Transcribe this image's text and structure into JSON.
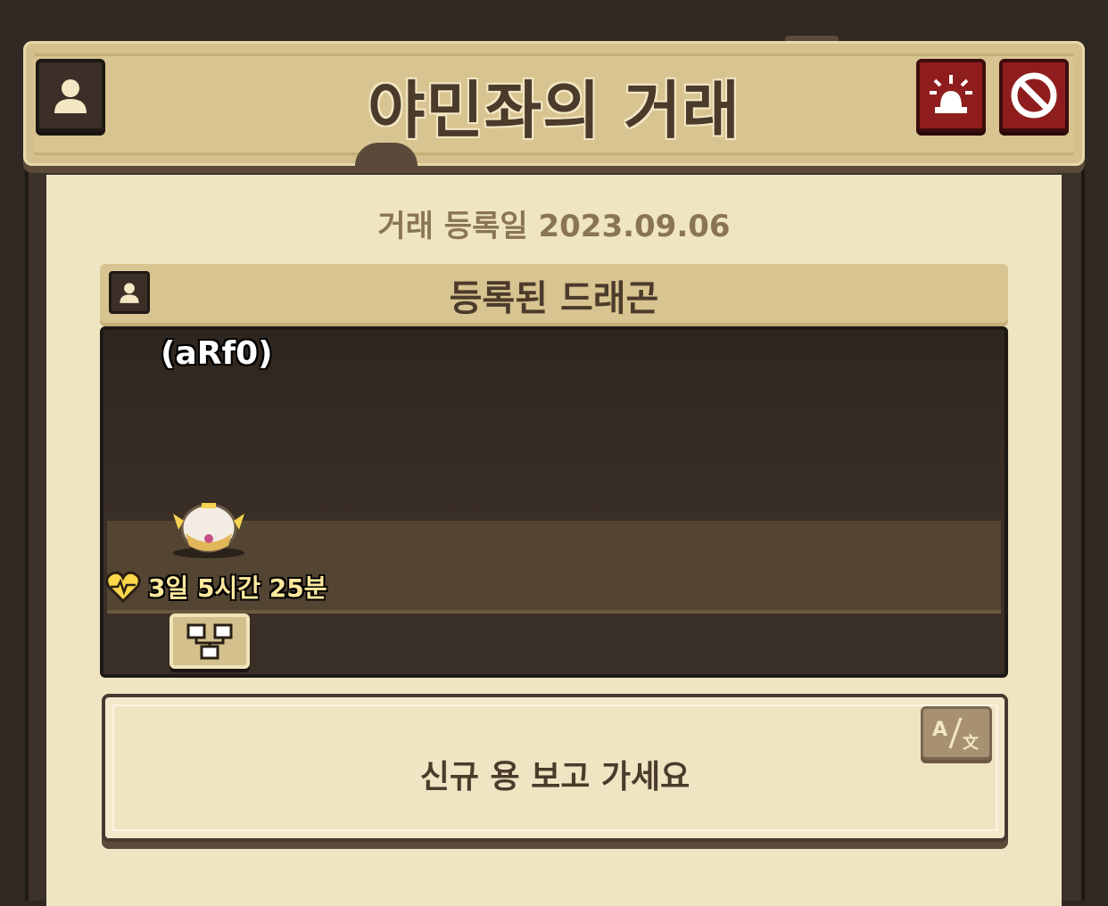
{
  "header": {
    "title": "야민좌의 거래"
  },
  "trade": {
    "registered_date": "거래 등록일 2023.09.06"
  },
  "dragon_section": {
    "title": "등록된 드래곤",
    "dragon_name": "(aRf0)",
    "timer": "3일 5시간 25분"
  },
  "message": {
    "text": "신규 용 보고 가세요"
  },
  "icons": {
    "profile": "profile-icon",
    "alarm": "alarm-icon",
    "block": "block-icon",
    "heart": "heart-icon",
    "family_tree": "family-tree-icon",
    "translate": "translate-icon"
  },
  "colors": {
    "background": "#2f2823",
    "header": "#d4c08c",
    "panel": "#efe5c3",
    "danger_button": "#8f1d1d",
    "title_text": "#4b3b2b"
  }
}
